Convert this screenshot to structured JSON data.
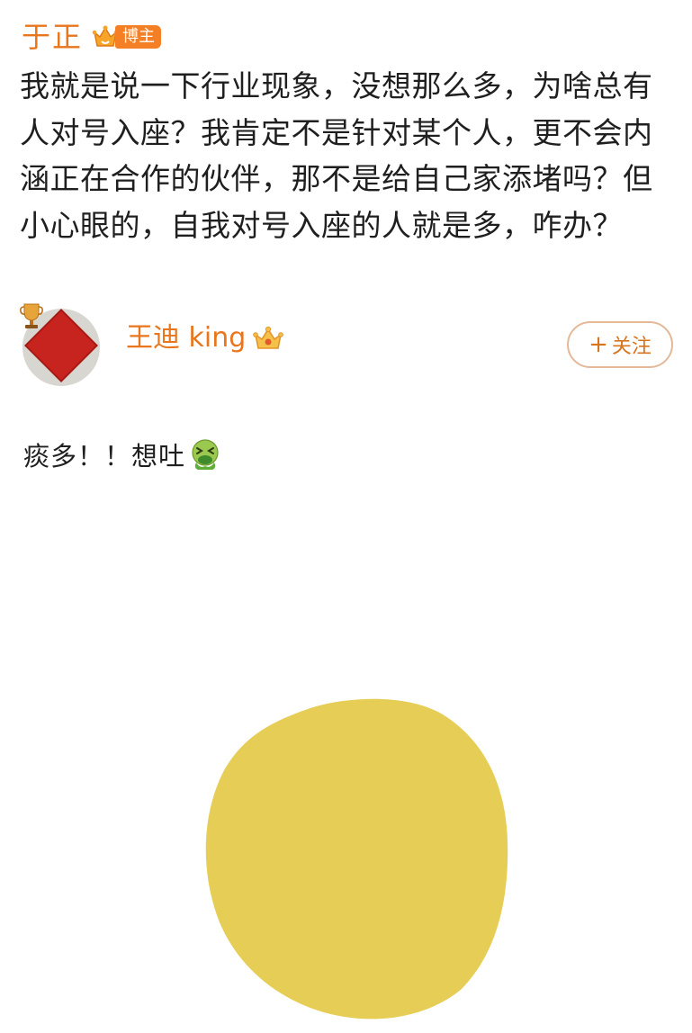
{
  "quote_post": {
    "author": "于正",
    "badge": "博主",
    "text": "我就是说一下行业现象，没想那么多，为啥总有人对号入座？我肯定不是针对某个人，更不会内涵正在合作的伙伴，那不是给自己家添堵吗？但小心眼的，自我对号入座的人就是多，咋办？"
  },
  "reply": {
    "author": "王迪 king",
    "follow_label": "关注",
    "text": "痰多！！想吐",
    "emoji": "vomiting-face-emoji",
    "avatar": "fu-character-avatar"
  },
  "colors": {
    "author_orange": "#e8761c",
    "badge_orange": "#f47f24",
    "follow_border": "#e4b999",
    "blob_yellow": "#e6cd55"
  }
}
